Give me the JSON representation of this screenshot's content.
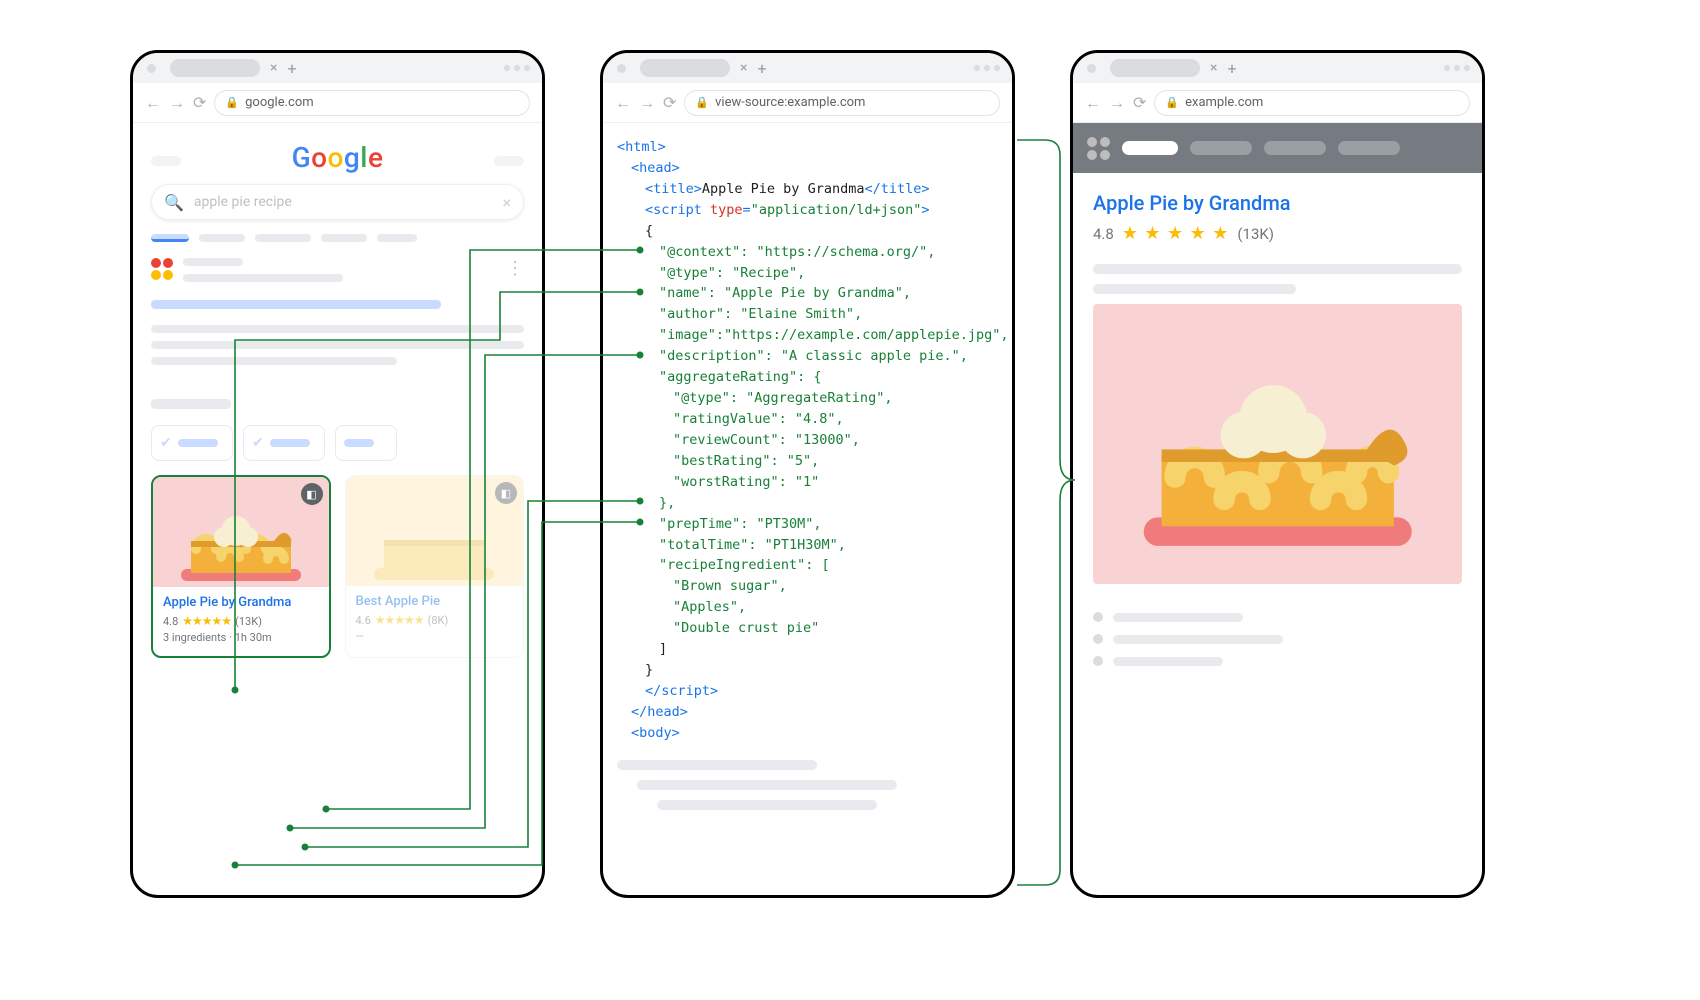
{
  "left": {
    "url": "google.com",
    "logo": {
      "g1": "G",
      "o1": "o",
      "o2": "o",
      "g2": "g",
      "l": "l",
      "e": "e"
    },
    "search_query": "apple pie recipe",
    "card": {
      "title": "Apple Pie by Grandma",
      "rating_value": "4.8",
      "rating_count": "(13K)",
      "meta": "3 ingredients · 1h 30m"
    },
    "card2_title": "Best Apple Pie"
  },
  "mid": {
    "url": "view-source:example.com",
    "code": {
      "html_open": "<html>",
      "head_open": "<head>",
      "title_open": "<title>",
      "title_text": "Apple Pie by Grandma",
      "title_close": "</title>",
      "script_open_a": "<script ",
      "script_type_key": "type",
      "script_type_eq": "=",
      "script_type_val": "\"application/ld+json\"",
      "script_open_b": ">",
      "brace_open": "{",
      "ctx": "\"@context\": \"https://schema.org/\",",
      "type": "\"@type\": \"Recipe\",",
      "name": "\"name\": \"Apple Pie by Grandma\",",
      "author": "\"author\": \"Elaine Smith\",",
      "image": "\"image\":\"https://example.com/applepie.jpg\",",
      "desc": "\"description\": \"A classic apple pie.\",",
      "agg_open": "\"aggregateRating\": {",
      "agg_type": "\"@type\": \"AggregateRating\",",
      "agg_val": "\"ratingValue\": \"4.8\",",
      "agg_count": "\"reviewCount\": \"13000\",",
      "agg_best": "\"bestRating\": \"5\",",
      "agg_worst": "\"worstRating\": \"1\"",
      "agg_close": "},",
      "prep": "\"prepTime\": \"PT30M\",",
      "total": "\"totalTime\": \"PT1H30M\",",
      "ingr_open": "\"recipeIngredient\": [",
      "ingr_1": "\"Brown sugar\",",
      "ingr_2": "\"Apples\",",
      "ingr_3": "\"Double crust pie\"",
      "ingr_close": "]",
      "brace_close": "}",
      "script_close": "</script>",
      "head_close": "</head>",
      "body_open": "<body>"
    }
  },
  "right": {
    "url": "example.com",
    "title": "Apple Pie by Grandma",
    "rating_value": "4.8",
    "rating_count": "(13K)"
  }
}
